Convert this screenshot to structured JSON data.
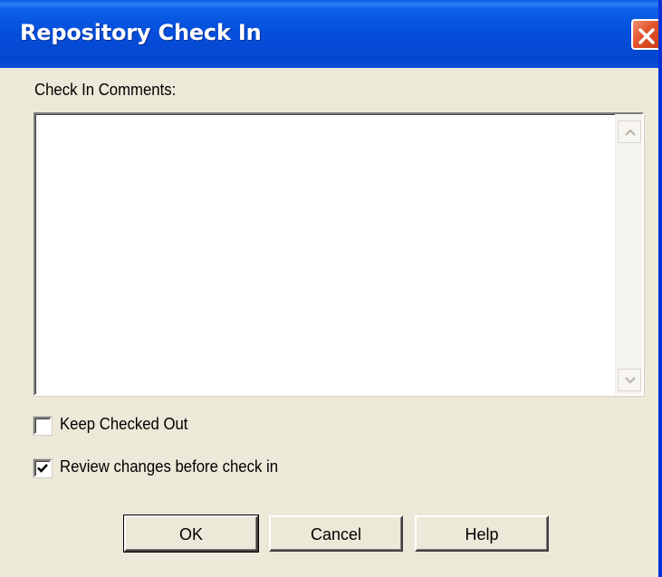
{
  "window": {
    "title": "Repository Check In"
  },
  "comments": {
    "label": "Check In Comments:",
    "value": ""
  },
  "options": {
    "keep_checked_out": {
      "label": "Keep Checked Out",
      "checked": false
    },
    "review_changes": {
      "label": "Review changes before check in",
      "checked": true
    }
  },
  "buttons": {
    "ok": "OK",
    "cancel": "Cancel",
    "help": "Help"
  },
  "icons": {
    "close": "close-icon",
    "scroll_up": "arrow-up-icon",
    "scroll_down": "arrow-down-icon",
    "checkmark": "checkmark-icon"
  },
  "colors": {
    "titlebar": "#0650dc",
    "dialog_face": "#ece9d8",
    "close_button": "#e2552e"
  }
}
